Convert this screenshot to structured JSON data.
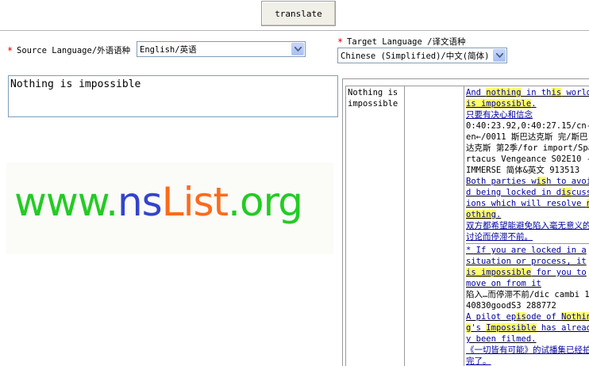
{
  "toolbar": {
    "translate_label": "translate"
  },
  "source": {
    "required_mark": "*",
    "label": "Source Language/外语语种",
    "selected": "English/英语"
  },
  "target": {
    "required_mark": "*",
    "label": "Target Language /译文语种",
    "selected": "Chinese (Simplified)/中文(简体)"
  },
  "input_text": "Nothing is impossible",
  "ad": {
    "www": "www.",
    "ns": "ns",
    "list": "List",
    "org": ".org"
  },
  "results": {
    "source_cell": "Nothing is impossible",
    "entries": [
      {
        "en": [
          [
            "And ",
            0
          ],
          [
            "nothing",
            1
          ],
          [
            " in th",
            0
          ],
          [
            "is",
            1
          ],
          [
            " world ",
            0
          ],
          [
            "is impossible",
            1
          ],
          [
            ".",
            0
          ]
        ],
        "zh": "只要有决心和信念",
        "meta": "0:40:23.92,0:40:27.15/cn-en←/0011 斯巴达克斯 完/斯巴达克斯 第2季/for import/Spartacus Vengeance S02E10 -IMMERSE 简体&英文 913513"
      },
      {
        "en": [
          [
            "Both parties ",
            0
          ],
          [
            "w",
            0
          ],
          [
            "is",
            1
          ],
          [
            "h to avoid being locked in d",
            0
          ],
          [
            "is",
            1
          ],
          [
            "cussions which will resolve ",
            0
          ],
          [
            "nothing",
            1
          ],
          [
            ".",
            0
          ]
        ],
        "zh": "双方都希望能避免陷入毫无意义的讨论而停滞不前。",
        "meta": ""
      },
      {
        "en": [
          [
            "* If you are locked in a situation or process, it ",
            0
          ],
          [
            "is impossible",
            1
          ],
          [
            " for you to move on from it",
            0
          ]
        ],
        "zh": "",
        "meta": "陷入…而停滞不前/dic cambi 140830goodS3 288772"
      },
      {
        "en": [
          [
            "A pilot ep",
            0
          ],
          [
            "is",
            1
          ],
          [
            "ode of ",
            0
          ],
          [
            "Nothing",
            1
          ],
          [
            "'s ",
            0
          ],
          [
            "Impossible",
            1
          ],
          [
            " has already been filmed.",
            0
          ]
        ],
        "zh": "《一切皆有可能》的试播集已经拍完了。",
        "meta": ""
      }
    ]
  },
  "colors": {
    "ad_www": "#22cc22",
    "ad_ns": "#3344cc",
    "ad_list": "#ff6a1a",
    "ad_org": "#22cc22",
    "highlight": "#ffff66",
    "zh_link": "#0000a0"
  }
}
